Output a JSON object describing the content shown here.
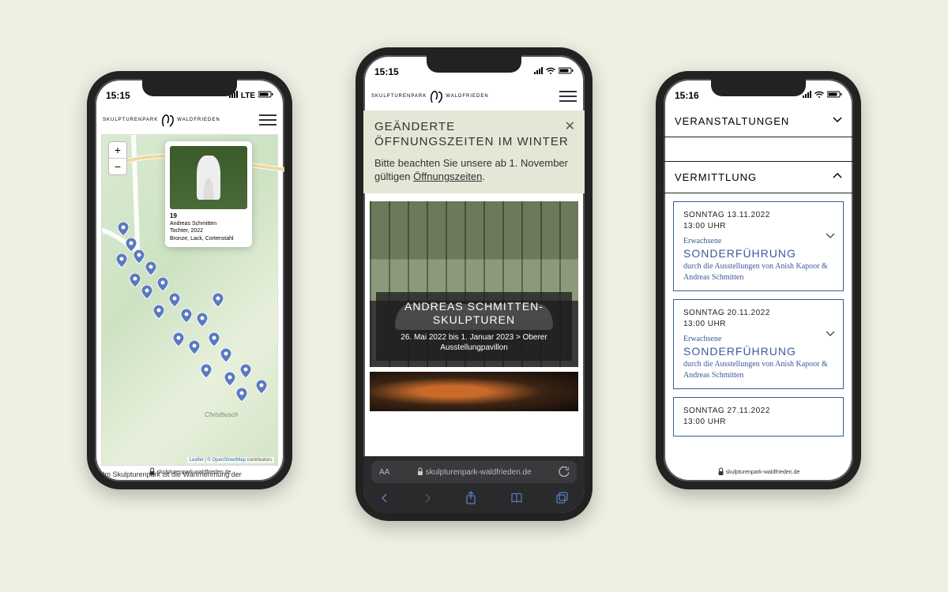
{
  "logo": {
    "left": "SKULPTURENPARK",
    "right": "WALDFRIEDEN"
  },
  "phone1": {
    "time": "15:15",
    "signal_label": "LTE",
    "popup": {
      "num": "19",
      "artist": "Andreas Schmitten",
      "title": "Tochter, 2022",
      "material": "Bronze, Lack, Cortenstahl"
    },
    "zoom": {
      "in": "+",
      "out": "−"
    },
    "park_label": "Christbusch",
    "attrib": {
      "leaflet": "Leaflet",
      "sep": " | © ",
      "osm": "OpenStreetMap",
      "tail": " contributors"
    },
    "caption": "Im Skulpturenpark ist die Wahrnehmung der",
    "url": "skulpturenpark-waldfrieden.de"
  },
  "phone2": {
    "time": "15:15",
    "notice": {
      "title": "GEÄNDERTE ÖFFNUNGSZEITEN IM WINTER",
      "body_pre": "Bitte beachten Sie unsere ab 1. November gültigen ",
      "link": "Öffnungszeiten",
      "body_post": "."
    },
    "hero": {
      "title": "ANDREAS SCHMITTEN-SKULPTUREN",
      "sub": "26. Mai 2022 bis 1. Januar 2023 > Oberer Ausstellungpavillon"
    },
    "addr": {
      "aa": "AA",
      "host": "skulpturenpark-waldfrieden.de"
    }
  },
  "phone3": {
    "time": "15:16",
    "acc1": "VERANSTALTUNGEN",
    "acc2": "VERMITTLUNG",
    "events": [
      {
        "date": "SONNTAG 13.11.2022",
        "time": "13:00 UHR",
        "aud": "Erwachsene",
        "title": "SONDERFÜHRUNG",
        "sub": "durch die Ausstellungen von Anish Kapoor & Andreas Schmitten"
      },
      {
        "date": "SONNTAG 20.11.2022",
        "time": "13:00 UHR",
        "aud": "Erwachsene",
        "title": "SONDERFÜHRUNG",
        "sub": "durch die Ausstellungen von Anish Kapoor & Andreas Schmitten"
      },
      {
        "date": "SONNTAG 27.11.2022",
        "time": "13:00 UHR",
        "aud": "",
        "title": "",
        "sub": ""
      }
    ],
    "url": "skulpturenpark-waldfrieden.de"
  }
}
